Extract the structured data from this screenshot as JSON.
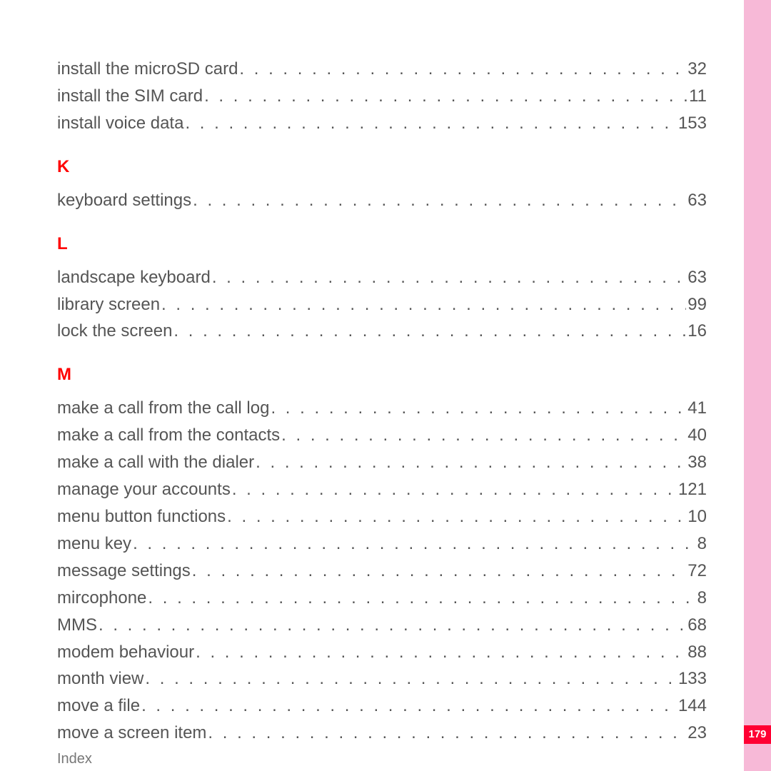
{
  "page_number": "179",
  "footer": "Index",
  "groups": [
    {
      "letter": "",
      "items": [
        {
          "label": "install the microSD card",
          "page": "32"
        },
        {
          "label": "install the SIM card",
          "page": "11"
        },
        {
          "label": "install voice data",
          "page": "153"
        }
      ]
    },
    {
      "letter": "K",
      "items": [
        {
          "label": "keyboard settings",
          "page": "63"
        }
      ]
    },
    {
      "letter": "L",
      "items": [
        {
          "label": "landscape keyboard",
          "page": "63"
        },
        {
          "label": "library screen",
          "page": "99"
        },
        {
          "label": "lock the screen",
          "page": "16"
        }
      ]
    },
    {
      "letter": "M",
      "items": [
        {
          "label": "make a call from the call log",
          "page": "41"
        },
        {
          "label": "make a call from the contacts",
          "page": "40"
        },
        {
          "label": "make a call with the dialer",
          "page": "38"
        },
        {
          "label": "manage your accounts",
          "page": "121"
        },
        {
          "label": "menu button functions",
          "page": "10"
        },
        {
          "label": "menu key",
          "page": "8"
        },
        {
          "label": "message settings",
          "page": "72"
        },
        {
          "label": "mircophone",
          "page": "8"
        },
        {
          "label": "MMS",
          "page": "68"
        },
        {
          "label": "modem behaviour",
          "page": "88"
        },
        {
          "label": "month view",
          "page": "133"
        },
        {
          "label": "move a file",
          "page": "144"
        },
        {
          "label": "move a screen item",
          "page": "23"
        }
      ]
    }
  ]
}
